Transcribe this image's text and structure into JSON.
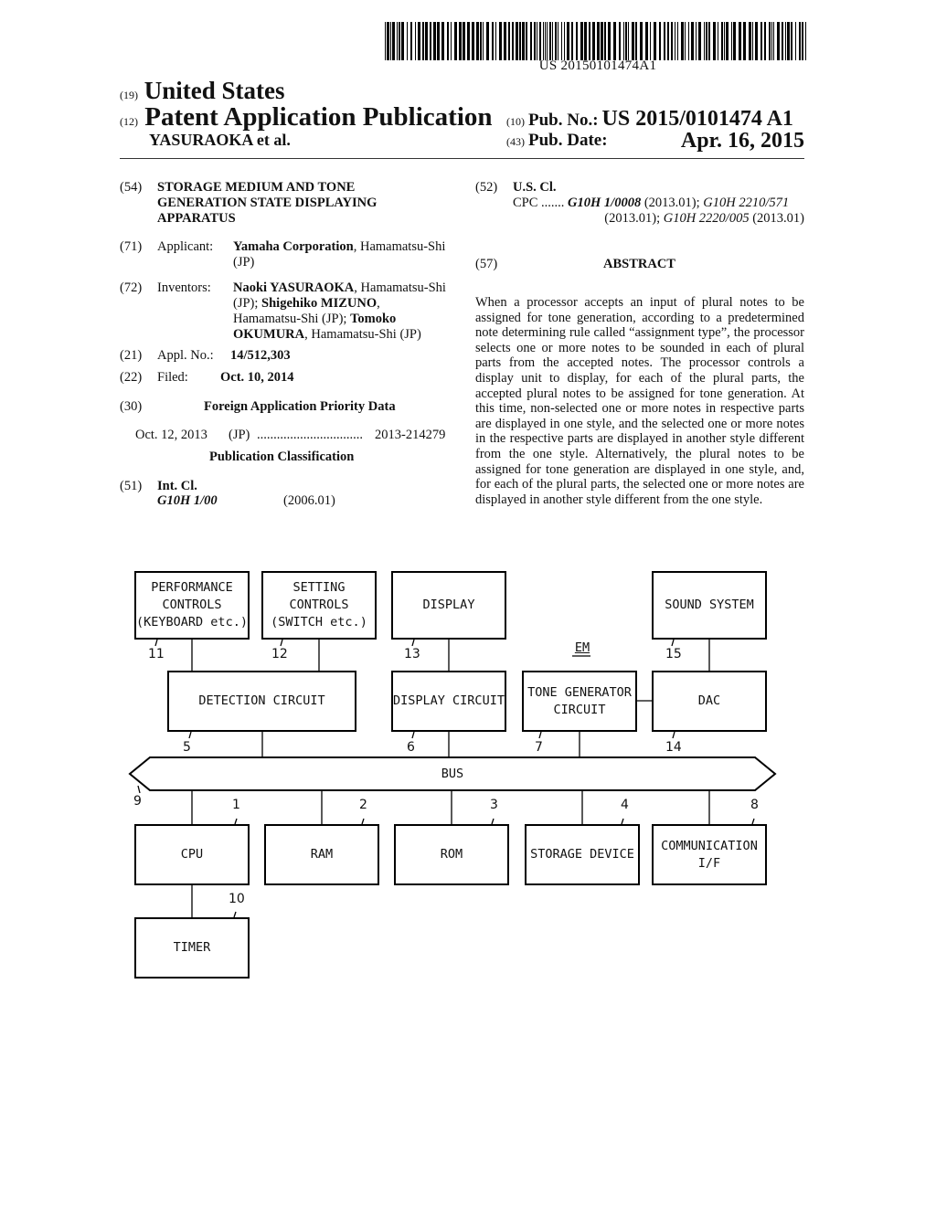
{
  "header": {
    "barcode_number": "US 20150101474A1",
    "country_code": "(19)",
    "country": "United States",
    "kind_code": "(12)",
    "kind": "Patent Application Publication",
    "inventor_short": "YASURAOKA et al.",
    "pub_no_code": "(10)",
    "pub_no_label": "Pub. No.:",
    "pub_no": "US 2015/0101474 A1",
    "pub_date_code": "(43)",
    "pub_date_label": "Pub. Date:",
    "pub_date": "Apr. 16, 2015"
  },
  "left_fields": {
    "title": {
      "code": "(54)",
      "lines": [
        "STORAGE MEDIUM AND TONE",
        "GENERATION STATE DISPLAYING",
        "APPARATUS"
      ]
    },
    "applicant": {
      "code": "(71)",
      "label": "Applicant:",
      "name": "Yamaha Corporation",
      "rest1": ", Hamamatsu-Shi",
      "rest2": "(JP)"
    },
    "inventors": {
      "code": "(72)",
      "label": "Inventors:",
      "n1": "Naoki YASURAOKA",
      "t1": ", Hamamatsu-Shi",
      "t2": "(JP); ",
      "n2": "Shigehiko MIZUNO",
      "t2b": ",",
      "t3": "Hamamatsu-Shi (JP); ",
      "n3a": "Tomoko",
      "n3b": "OKUMURA",
      "t4": ", Hamamatsu-Shi (JP)"
    },
    "appl_no": {
      "code": "(21)",
      "label": "Appl. No.:",
      "value": "14/512,303"
    },
    "filed": {
      "code": "(22)",
      "label": "Filed:",
      "value": "Oct. 10, 2014"
    },
    "priority": {
      "code": "(30)",
      "heading": "Foreign Application Priority Data",
      "date": "Oct. 12, 2013",
      "country": "(JP)",
      "dots": "................................",
      "number": "2013-214279"
    },
    "pub_class_heading": "Publication Classification",
    "int_cl": {
      "code": "(51)",
      "label": "Int. Cl.",
      "class": "G10H 1/00",
      "version": "(2006.01)"
    }
  },
  "right_fields": {
    "us_cl": {
      "code": "(52)",
      "label": "U.S. Cl.",
      "cpc_label": "CPC",
      "cpc_dots": ".......",
      "c1": "G10H 1/0008",
      "v1": " (2013.01); ",
      "c2": "G10H 2210/571",
      "v2": "(2013.01); ",
      "c3": "G10H 2220/005",
      "v3": " (2013.01)"
    },
    "abstract": {
      "code": "(57)",
      "heading": "ABSTRACT",
      "text": "When a processor accepts an input of plural notes to be assigned for tone generation, according to a predetermined note determining rule called “assignment type”, the processor selects one or more notes to be sounded in each of plural parts from the accepted notes. The processor controls a display unit to display, for each of the plural parts, the accepted plural notes to be assigned for tone generation. At this time, non-selected one or more notes in respective parts are displayed in one style, and the selected one or more notes in the respective parts are displayed in another style different from the one style. Alternatively, the plural notes to be assigned for tone generation are displayed in one style, and, for each of the plural parts, the selected one or more notes are displayed in another style different from the one style."
    }
  },
  "diagram": {
    "system_label": "EM",
    "bus_label": "BUS",
    "bus_ref": "9",
    "blocks": {
      "performance": {
        "lines": [
          "PERFORMANCE",
          "CONTROLS",
          "(KEYBOARD etc.)"
        ],
        "ref": "11"
      },
      "setting": {
        "lines": [
          "SETTING",
          "CONTROLS",
          "(SWITCH etc.)"
        ],
        "ref": "12"
      },
      "display": {
        "lines": [
          "DISPLAY"
        ],
        "ref": "13"
      },
      "sound": {
        "lines": [
          "SOUND SYSTEM"
        ],
        "ref": "15"
      },
      "detection": {
        "lines": [
          "DETECTION CIRCUIT"
        ],
        "ref": "5"
      },
      "display_circuit": {
        "lines": [
          "DISPLAY CIRCUIT"
        ],
        "ref": "6"
      },
      "tone": {
        "lines": [
          "TONE GENERATOR",
          "CIRCUIT"
        ],
        "ref": "7"
      },
      "dac": {
        "lines": [
          "DAC"
        ],
        "ref": "14"
      },
      "cpu": {
        "lines": [
          "CPU"
        ],
        "ref": "1"
      },
      "ram": {
        "lines": [
          "RAM"
        ],
        "ref": "2"
      },
      "rom": {
        "lines": [
          "ROM"
        ],
        "ref": "3"
      },
      "storage": {
        "lines": [
          "STORAGE DEVICE"
        ],
        "ref": "4"
      },
      "comm": {
        "lines": [
          "COMMUNICATION",
          "I/F"
        ],
        "ref": "8"
      },
      "timer": {
        "lines": [
          "TIMER"
        ],
        "ref": "10"
      }
    }
  }
}
